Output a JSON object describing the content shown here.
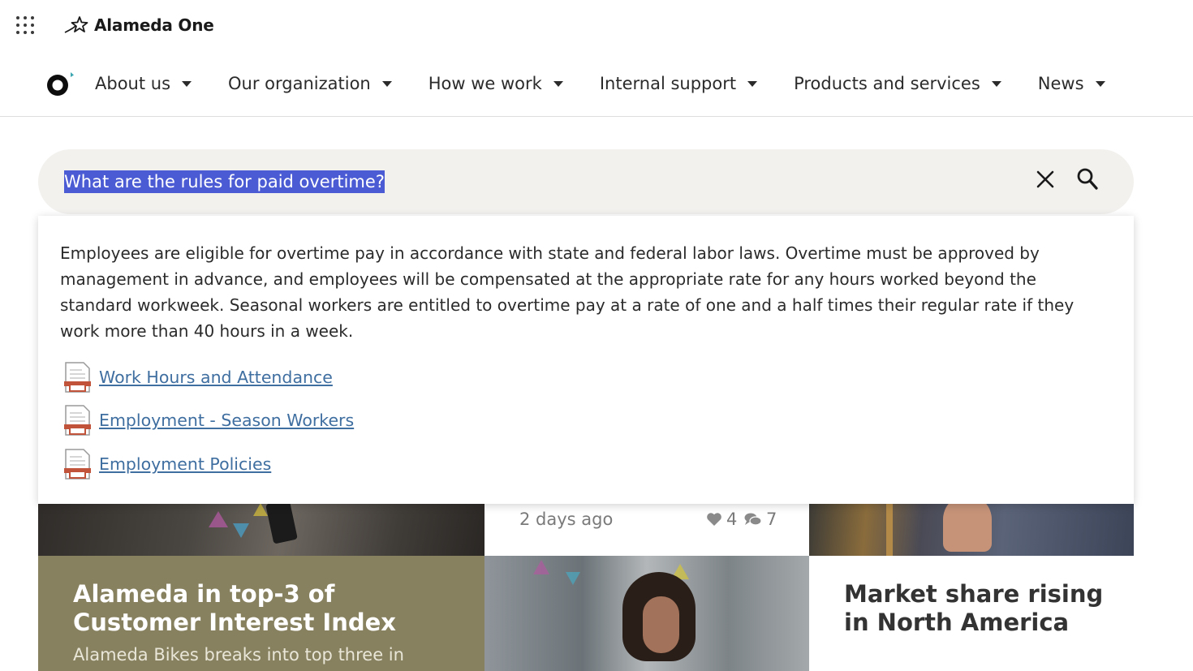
{
  "brand": {
    "name": "Alameda One"
  },
  "nav": {
    "items": [
      {
        "label": "About us"
      },
      {
        "label": "Our organization"
      },
      {
        "label": "How we work"
      },
      {
        "label": "Internal support"
      },
      {
        "label": "Products and services"
      },
      {
        "label": "News"
      }
    ]
  },
  "search": {
    "value": "What are the rules for paid overtime?",
    "placeholder": ""
  },
  "answer": {
    "text": "Employees are eligible for overtime pay in accordance with state and federal labor laws. Overtime must be approved by management in advance, and employees will be compensated at the appropriate rate for any hours worked beyond the standard workweek. Seasonal workers are entitled to overtime pay at a rate of one and a half times their regular rate if they work more than 40 hours in a week.",
    "links": [
      {
        "label": "Work Hours and Attendance",
        "icon": "document-icon"
      },
      {
        "label": "Employment - Season Workers",
        "icon": "document-icon"
      },
      {
        "label": "Employment Policies",
        "icon": "document-icon"
      }
    ]
  },
  "cards": {
    "meta": {
      "time": "2 days ago",
      "likes": "4",
      "comments": "7"
    },
    "olive": {
      "title": "Alameda in top-3 of Customer Interest Index",
      "subtitle": "Alameda Bikes breaks into top three in"
    },
    "white": {
      "title": "Market share rising in North America"
    }
  },
  "colors": {
    "selection": "#4b5bd3",
    "link": "#3f6ea0",
    "olive": "#878160",
    "search_bg": "#f2f1ee"
  }
}
